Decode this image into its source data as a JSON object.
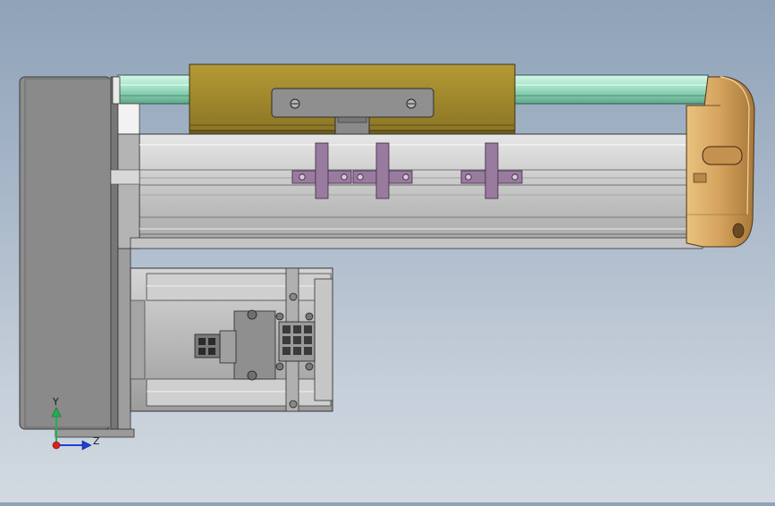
{
  "viewport": {
    "description_hidden": false,
    "background_top": "#8fa2b8",
    "background_bottom": "#d2d9e1"
  },
  "triad": {
    "y_label": "Y",
    "z_label": "Z",
    "y_color": "#22b14c",
    "z_color": "#1f3fd6",
    "origin_color": "#d62020"
  },
  "colors": {
    "end_plate": "#8c8c8c",
    "rail_green": "#9fe0c4",
    "carriage_olive": "#a08a2e",
    "actuator_body": "#c9c9c9",
    "clamp_purple": "#9a7ba0",
    "end_cap_tan": "#d4a25c",
    "motor_body": "#bdbdbd"
  }
}
